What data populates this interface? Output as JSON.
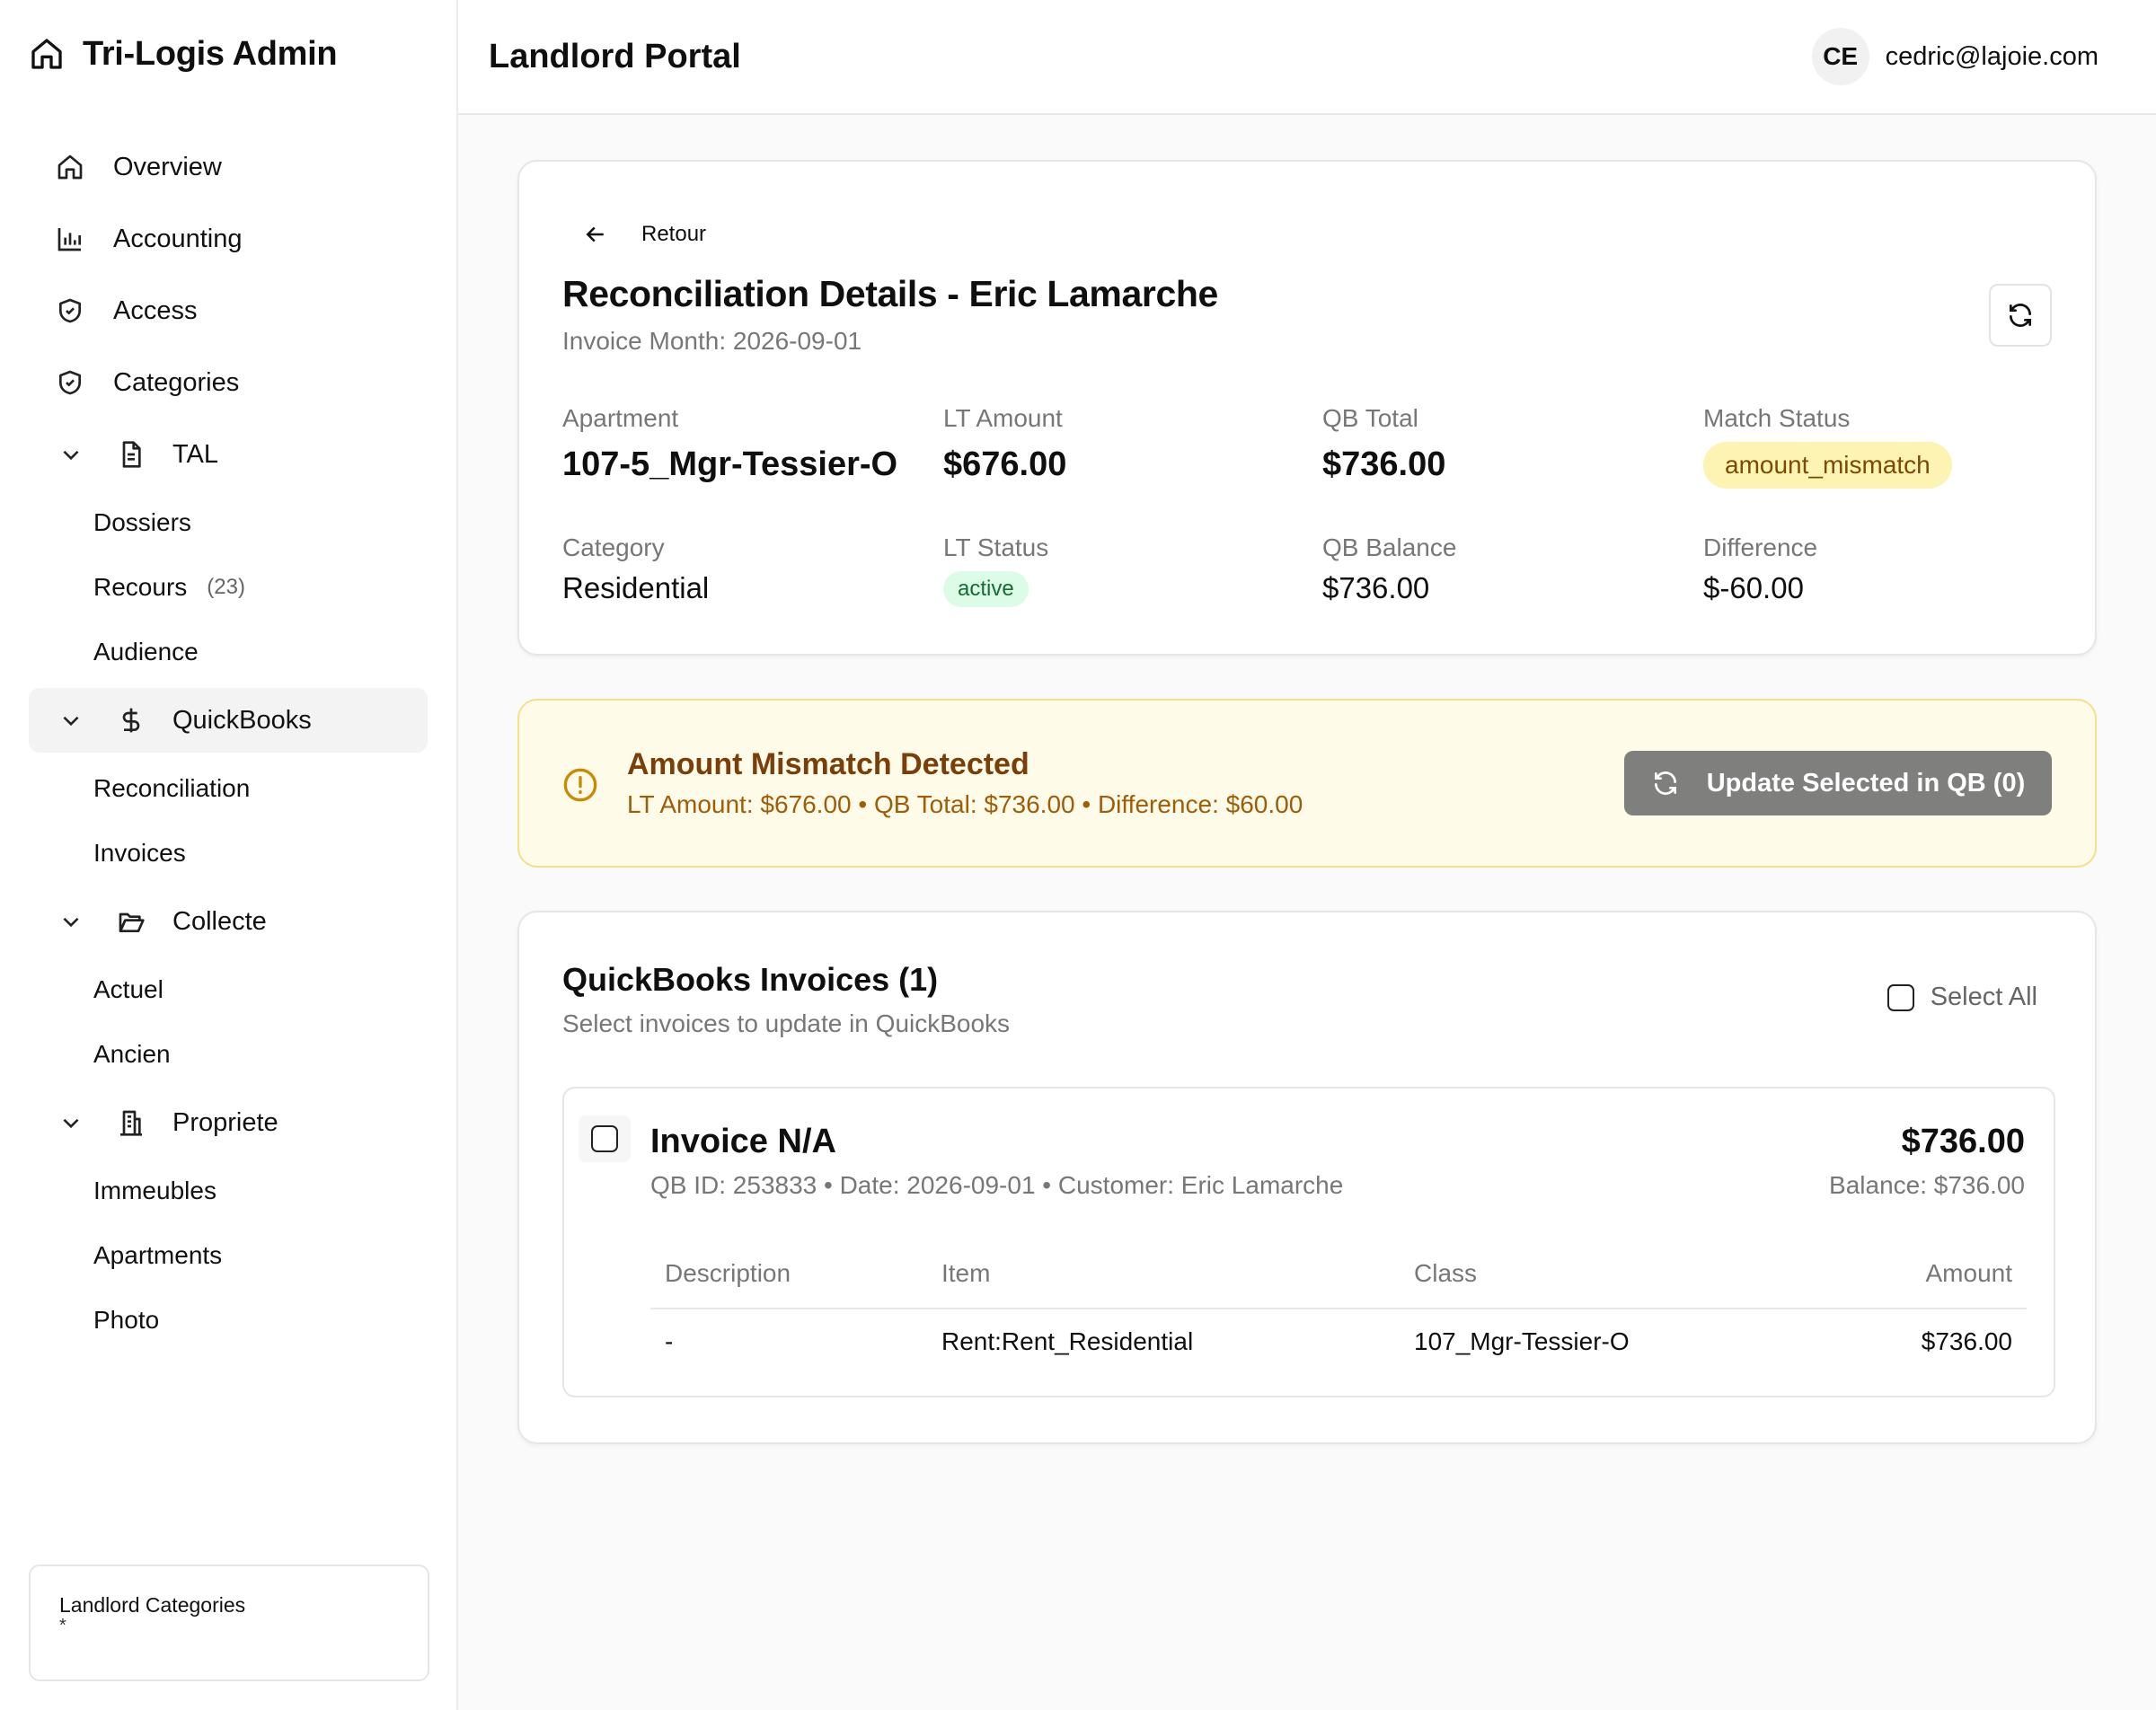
{
  "sidebar": {
    "brand": "Tri-Logis Admin",
    "items": [
      {
        "label": "Overview",
        "icon": "home-icon"
      },
      {
        "label": "Accounting",
        "icon": "bar-chart-icon"
      },
      {
        "label": "Access",
        "icon": "shield-icon"
      },
      {
        "label": "Categories",
        "icon": "shield-icon"
      }
    ],
    "groups": [
      {
        "label": "TAL",
        "icon": "file-icon",
        "children": [
          {
            "label": "Dossiers"
          },
          {
            "label": "Recours",
            "count": "(23)"
          },
          {
            "label": "Audience"
          }
        ]
      },
      {
        "label": "QuickBooks",
        "icon": "dollar-icon",
        "active": true,
        "children": [
          {
            "label": "Reconciliation"
          },
          {
            "label": "Invoices"
          }
        ]
      },
      {
        "label": "Collecte",
        "icon": "folder-open-icon",
        "children": [
          {
            "label": "Actuel"
          },
          {
            "label": "Ancien"
          }
        ]
      },
      {
        "label": "Propriete",
        "icon": "building-icon",
        "children": [
          {
            "label": "Immeubles"
          },
          {
            "label": "Apartments"
          },
          {
            "label": "Photo"
          }
        ]
      }
    ],
    "footer": {
      "title": "Landlord Categories",
      "sub": "*"
    }
  },
  "header": {
    "title": "Landlord Portal",
    "avatar": "CE",
    "email": "cedric@lajoie.com"
  },
  "details": {
    "back": "Retour",
    "title": "Reconciliation Details - Eric Lamarche",
    "subtitle": "Invoice Month: 2026-09-01",
    "fields": {
      "apartment_label": "Apartment",
      "apartment": "107-5_Mgr-Tessier-O",
      "lt_amount_label": "LT Amount",
      "lt_amount": "$676.00",
      "qb_total_label": "QB Total",
      "qb_total": "$736.00",
      "match_status_label": "Match Status",
      "match_status": "amount_mismatch",
      "category_label": "Category",
      "category": "Residential",
      "lt_status_label": "LT Status",
      "lt_status": "active",
      "qb_balance_label": "QB Balance",
      "qb_balance": "$736.00",
      "difference_label": "Difference",
      "difference": "$-60.00"
    }
  },
  "alert": {
    "title": "Amount Mismatch Detected",
    "desc": "LT Amount: $676.00 • QB Total: $736.00 • Difference: $60.00",
    "button": "Update Selected in QB (0)"
  },
  "invoices": {
    "title": "QuickBooks Invoices (1)",
    "subtitle": "Select invoices to update in QuickBooks",
    "select_all": "Select All",
    "items": [
      {
        "title": "Invoice N/A",
        "meta": "QB ID: 253833 • Date: 2026-09-01 • Customer: Eric Lamarche",
        "amount": "$736.00",
        "balance": "Balance: $736.00",
        "columns": [
          "Description",
          "Item",
          "Class",
          "Amount"
        ],
        "lines": [
          {
            "description": "-",
            "item": "Rent:Rent_Residential",
            "class": "107_Mgr-Tessier-O",
            "amount": "$736.00"
          }
        ]
      }
    ]
  },
  "colors": {
    "warning_bg": "#fefbe8",
    "warning_text": "#7a3e08",
    "status_active": "#dcfce7",
    "status_mismatch": "#fdf3b3"
  }
}
